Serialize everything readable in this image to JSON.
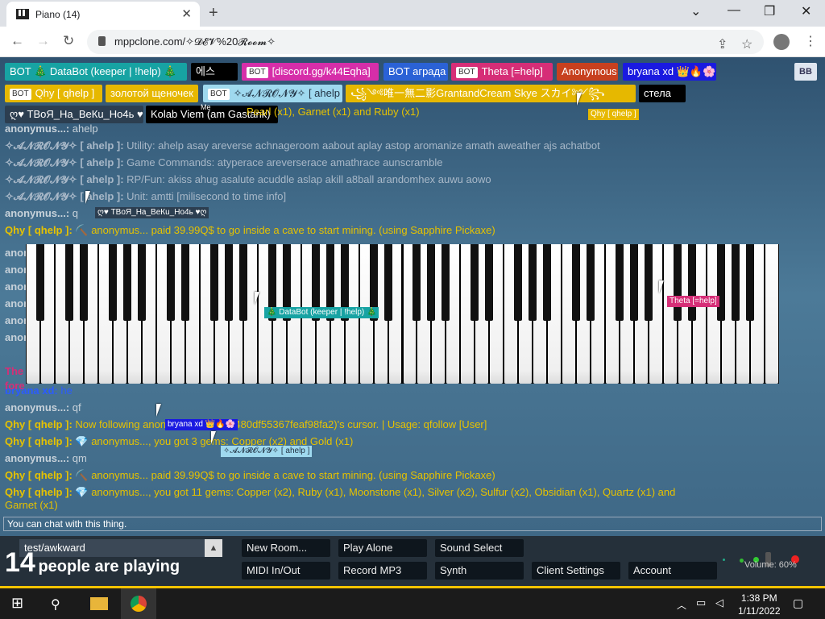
{
  "browser": {
    "tab_title": "Piano (14)",
    "url": "mppclone.com/✧𝓓𝓔𝓥%20𝓡𝓸𝓸𝓶✧",
    "close_glyph": "✕",
    "newtab_glyph": "+"
  },
  "users": [
    {
      "label": "BOT 🎄 DataBot (keeper | !help) 🎄",
      "color": "#17a3a3"
    },
    {
      "label": "에스",
      "color": "#000000"
    },
    {
      "label": "[discord.gg/k44Eqha]",
      "color": "#d62ea9",
      "bot": true
    },
    {
      "label": "BOT аграда",
      "color": "#2b62d6"
    },
    {
      "label": "Theta [=help]",
      "color": "#d62e77",
      "bot": true
    },
    {
      "label": "Anonymous",
      "color": "#c7401f"
    },
    {
      "label": "bryana xd 👑🔥🌸",
      "color": "#1a1ae0"
    },
    {
      "label": "Qhy [ qhelp ]",
      "color": "#e6b800",
      "bot": true
    },
    {
      "label": "золотой щеночек",
      "color": "#e6b800"
    },
    {
      "label": "✧𝓐𝓝𝓡𝓞𝓝𝓨✧ [ ahelp ]",
      "color": "#9fd9ef",
      "bot": true
    },
    {
      "label": "꧁༺唯一無二影GrantandCream Skye スカイ༻꧂",
      "color": "#e6b800"
    },
    {
      "label": "стела",
      "color": "#000000"
    },
    {
      "label": "ღ♥ ТВоЯ_На_ВеКu_Ho4ь ♥ღ",
      "color": "#2c3e50"
    },
    {
      "label": "Kolab Viem (am Gastank)",
      "color": "#000000"
    }
  ],
  "bot_badge": "BOT",
  "me_label": "Me",
  "toggle_label": "ВВ",
  "chat": [
    {
      "name": "",
      "text": "Pearl (x1), Garnet (x1) and Ruby (x1)",
      "ncolor": "#e6c200",
      "tcolor": "#e6c200"
    },
    {
      "name": "anonymus...:",
      "text": "ahelp",
      "ncolor": "#c8d2da",
      "tcolor": "#c8d2da"
    },
    {
      "name": "✧𝓐𝓝𝓡𝓞𝓝𝓨✧ [ ahelp ]:",
      "text": "Utility: ahelp asay areverse achnageroom aabout aplay astop aromanize amath aweather ajs achatbot",
      "ncolor": "#a8b8c8",
      "tcolor": "#a8b8c8"
    },
    {
      "name": "✧𝓐𝓝𝓡𝓞𝓝𝓨✧ [ ahelp ]:",
      "text": "Game Commands: atyperace areverserace amathrace aunscramble",
      "ncolor": "#a8b8c8",
      "tcolor": "#a8b8c8"
    },
    {
      "name": "✧𝓐𝓝𝓡𝓞𝓝𝓨✧ [ ahelp ]:",
      "text": "RP/Fun: akiss ahug asalute acuddle aslap akill a8ball arandomhex auwu aowo",
      "ncolor": "#a8b8c8",
      "tcolor": "#a8b8c8"
    },
    {
      "name": "✧𝓐𝓝𝓡𝓞𝓝𝓨✧ [ ahelp ]:",
      "text": "Unit: amtti [milisecond to time info]",
      "ncolor": "#a8b8c8",
      "tcolor": "#a8b8c8"
    },
    {
      "name": "anonymus...:",
      "text": "q",
      "ncolor": "#c8d2da",
      "tcolor": "#c8d2da"
    },
    {
      "name": "Qhy [ qhelp ]:",
      "text": "⛏️ anonymus... paid 39.99Q$ to go inside a cave to start mining. (using Sapphire Pickaxe)",
      "ncolor": "#e6c200",
      "tcolor": "#e6c200"
    },
    {
      "name": "bryana xd:",
      "text": "he",
      "ncolor": "#2b5bff",
      "tcolor": "#2b5bff"
    },
    {
      "name": "anonymus...:",
      "text": "qf",
      "ncolor": "#c8d2da",
      "tcolor": "#c8d2da"
    },
    {
      "name": "Qhy [ qhelp ]:",
      "text": "Now following anonymus... (19ac9480df55367feaf98fa2)'s cursor. | Usage: qfollow [User]",
      "ncolor": "#e6c200",
      "tcolor": "#e6c200"
    },
    {
      "name": "Qhy [ qhelp ]:",
      "text": "💎 anonymus..., you got 3 gems: Copper (x2) and Gold (x1)",
      "ncolor": "#e6c200",
      "tcolor": "#e6c200"
    },
    {
      "name": "anonymus...:",
      "text": "qm",
      "ncolor": "#c8d2da",
      "tcolor": "#c8d2da"
    },
    {
      "name": "Qhy [ qhelp ]:",
      "text": "⛏️ anonymus... paid 39.99Q$ to go inside a cave to start mining. (using Sapphire Pickaxe)",
      "ncolor": "#e6c200",
      "tcolor": "#e6c200"
    },
    {
      "name": "Qhy [ qhelp ]:",
      "text": "💎 anonymus..., you got 11 gems: Copper (x2), Ruby (x1), Moonstone (x1), Silver (x2), Sulfur (x2), Obsidian (x1), Quartz (x1) and",
      "ncolor": "#e6c200",
      "tcolor": "#e6c200"
    },
    {
      "name": "",
      "text": "Garnet (x1)",
      "ncolor": "#e6c200",
      "tcolor": "#e6c200"
    }
  ],
  "partial_names": [
    "anony",
    "anon",
    "anon",
    "anon",
    "anon",
    "anon",
    "The",
    "fore"
  ],
  "cursors": [
    {
      "label": "Qhy [ qhelp ]",
      "color": "#e6b800"
    },
    {
      "label": "ღ♥ ТВоЯ_На_ВеКu_Ho4ь ♥ღ",
      "color": "#2c3e50"
    },
    {
      "label": "🎄 DataBot (keeper | !help) 🎄",
      "color": "#17a3a3"
    },
    {
      "label": "Theta [=help]",
      "color": "#d62e77"
    },
    {
      "label": "bryana xd 👑🔥🌸",
      "color": "#1a1ae0"
    },
    {
      "label": "✧𝓐𝓝𝓡𝓞𝓝𝓨✧ [ ahelp ]",
      "color": "#9fd9ef"
    },
    {
      "label": "золотой щеночек",
      "color": "#e6b800"
    },
    {
      "label": "[discord.gg/k44Eqha]",
      "color": "#d62ea9"
    }
  ],
  "chat_hint": "You can chat with this thing.",
  "chat_input": "test/awkward",
  "player_count": "14",
  "player_text": "people are playing",
  "buttons": [
    "New Room...",
    "Play Alone",
    "Sound Select",
    "MIDI In/Out",
    "Record MP3",
    "Synth",
    "Client Settings",
    "Account"
  ],
  "volume": "Volume: 60%",
  "clock": {
    "time": "1:38 PM",
    "date": "1/11/2022"
  }
}
